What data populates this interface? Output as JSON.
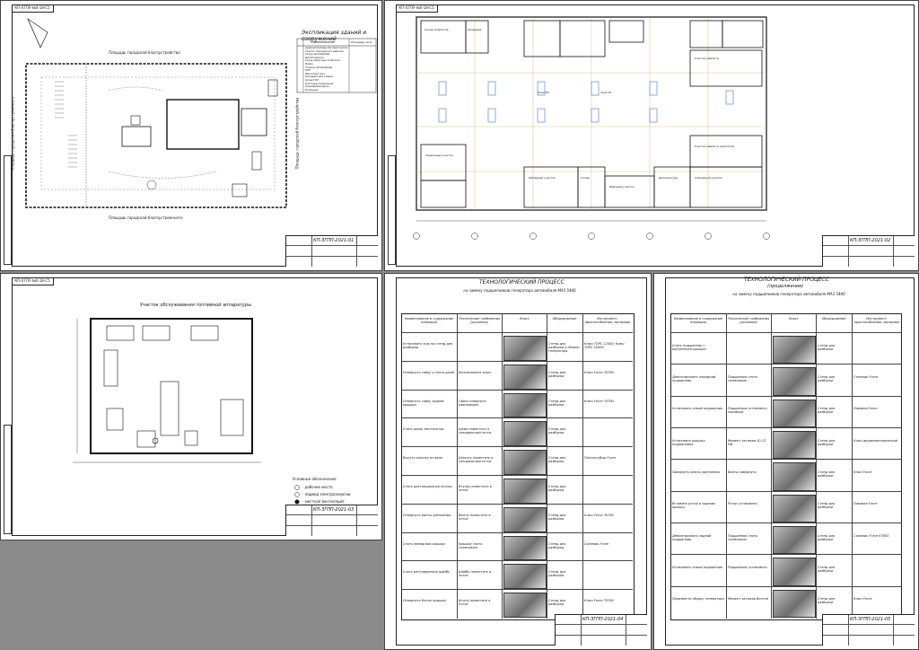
{
  "sheets": {
    "s1": {
      "corner_code": "КП-07ПУ-№0-18-С5",
      "title": "Экспликация зданий и сооружений",
      "label_top": "Площадь городской благоустройства",
      "label_bottom": "Площадь городской благоустроенного",
      "label_left": "Площадь городская благоустроенного",
      "label_right": "Площадь городской благоустройства",
      "table_header_name": "Наименование",
      "table_header_area": "Площадь, кв.м",
      "doc_code": "КП-ЗГПП-2021-01",
      "rows": [
        "Административно-бытовой корпус",
        "Участок технического ремонта",
        "Склад автомобилей",
        "Диспетчерская",
        "Склад оборотных агрегатов",
        "Мойка",
        "Стоянка автомобилей",
        "КПП",
        "Ремонтная зона",
        "Площадка для отдыха",
        "Склад ГСМ",
        "Очистные сооружения",
        "Трансформаторная",
        "Котельная"
      ]
    },
    "s2": {
      "corner_code": "КП-07ПУ-№0-18-С5",
      "doc_code": "КП-ЗГПП-2021-02",
      "zone_labels": [
        "Склад агрегатов",
        "Кладовая",
        "Зона ТО",
        "Зона ТР",
        "Участок ремонта",
        "Сварочный участок",
        "Малярный участок",
        "Склад",
        "Моечный участок",
        "Слесарный участок",
        "Участок ремонта агрегатов",
        "Шиномонтаж"
      ]
    },
    "s3": {
      "corner_code": "КП-07ПУ-№0-18-С5",
      "title": "Участок обслуживания топливной аппаратуры",
      "doc_code": "КП-ЗГПП-2021-03",
      "legend_title": "Условные обозначения",
      "legend": [
        "- рабочее место",
        "- подвод электроэнергии",
        "- местная вентиляция"
      ]
    },
    "s4": {
      "title": "ТЕХНОЛОГИЧЕСКИЙ ПРОЦЕСС",
      "subtitle": "на замену подшипников генератора автомобиля МАЗ 5440",
      "doc_code": "КП-ЗГПП-2021-04",
      "headers": [
        "Наименование и содержание операции",
        "Технические требования (указания)",
        "Эскиз",
        "Оборудование",
        "Инструмент, приспособления, материал"
      ],
      "rows": [
        {
          "op": "Установить нож на стенд для разборки",
          "req": "",
          "eq": "Стенд для разборки и сборки генератора",
          "tool": "Ключ ТОРС 12500, Ключ ТОРС 22000"
        },
        {
          "op": "Отвернуть гайку и снять шкив",
          "req": "Использовать ключ",
          "eq": "Стенд для разборки",
          "tool": "Ключ Force 70700"
        },
        {
          "op": "Отвернуть гайку задней крышки",
          "req": "Гайки отвернуть равномерно",
          "eq": "Стенд для разборки",
          "tool": "Ключ Force 70700"
        },
        {
          "op": "Снять шкив, вентилятор",
          "req": "Шкив поместить в специальный лоток",
          "eq": "Стенд для разборки",
          "tool": ""
        },
        {
          "op": "Вынуть шпонку из вала",
          "req": "Шпонку поместить в специальный лоток",
          "eq": "Стенд для разборки",
          "tool": "Плоскогубцы Force"
        },
        {
          "op": "Снять дистанционную втулку",
          "req": "Втулку поместить в лоток",
          "eq": "Стенд для разборки",
          "tool": ""
        },
        {
          "op": "Отвернуть винты крепления",
          "req": "Винты поместить в лоток",
          "eq": "Стенд для разборки",
          "tool": "Ключ Force 70700"
        },
        {
          "op": "Снять переднюю крышку",
          "req": "Крышку снять съемником",
          "eq": "Стенд для разборки",
          "tool": "Съемник Force"
        },
        {
          "op": "Снять регулируемую шайбу",
          "req": "Шайбу поместить в лоток",
          "eq": "Стенд для разборки",
          "tool": ""
        },
        {
          "op": "Отвернуть болты крышки",
          "req": "Болты поместить в лоток",
          "eq": "Стенд для разборки",
          "tool": "Ключ Force 70700"
        }
      ]
    },
    "s5": {
      "title": "ТЕХНОЛОГИЧЕСКИЙ ПРОЦЕСС",
      "title2": "(продолжение)",
      "subtitle": "на замену подшипников генератора автомобиля МАЗ 5440",
      "doc_code": "КП-ЗГПП-2021-05",
      "headers": [
        "Наименование и содержание операции",
        "Технические требования (указания)",
        "Эскиз",
        "Оборудование",
        "Инструмент, приспособления, материал"
      ],
      "rows": [
        {
          "op": "Снять подшипник с внутренней крышки",
          "req": "",
          "eq": "Стенд для разборки",
          "tool": ""
        },
        {
          "op": "Демонтировать передний подшипник",
          "req": "Подшипник снять съемником",
          "eq": "Стенд для разборки",
          "tool": "Съемник Force"
        },
        {
          "op": "Установить новый подшипник",
          "req": "Подшипник установить оправкой",
          "eq": "Стенд для разборки",
          "tool": "Оправка Force"
        },
        {
          "op": "Установить крышку подшипника",
          "req": "Момент затяжки 10-12 Нм",
          "eq": "Стенд для разборки",
          "tool": "Ключ динамометрический"
        },
        {
          "op": "Завернуть винты крепления",
          "req": "Винты завернуть",
          "eq": "Стенд для разборки",
          "tool": "Ключ Force"
        },
        {
          "op": "Вставить ротор в заднюю крышку",
          "req": "Ротор установить",
          "eq": "Стенд для разборки",
          "tool": "Оправка Force"
        },
        {
          "op": "Демонтировать задний подшипник",
          "req": "Подшипник снять съемником",
          "eq": "Стенд для разборки",
          "tool": "Съемник Force 67605"
        },
        {
          "op": "Установить новый подшипник",
          "req": "Подшипник установить",
          "eq": "Стенд для разборки",
          "tool": ""
        },
        {
          "op": "Произвести сборку генератора",
          "req": "Момент затяжки болтов",
          "eq": "Стенд для разборки",
          "tool": "Ключ Force"
        }
      ]
    }
  }
}
